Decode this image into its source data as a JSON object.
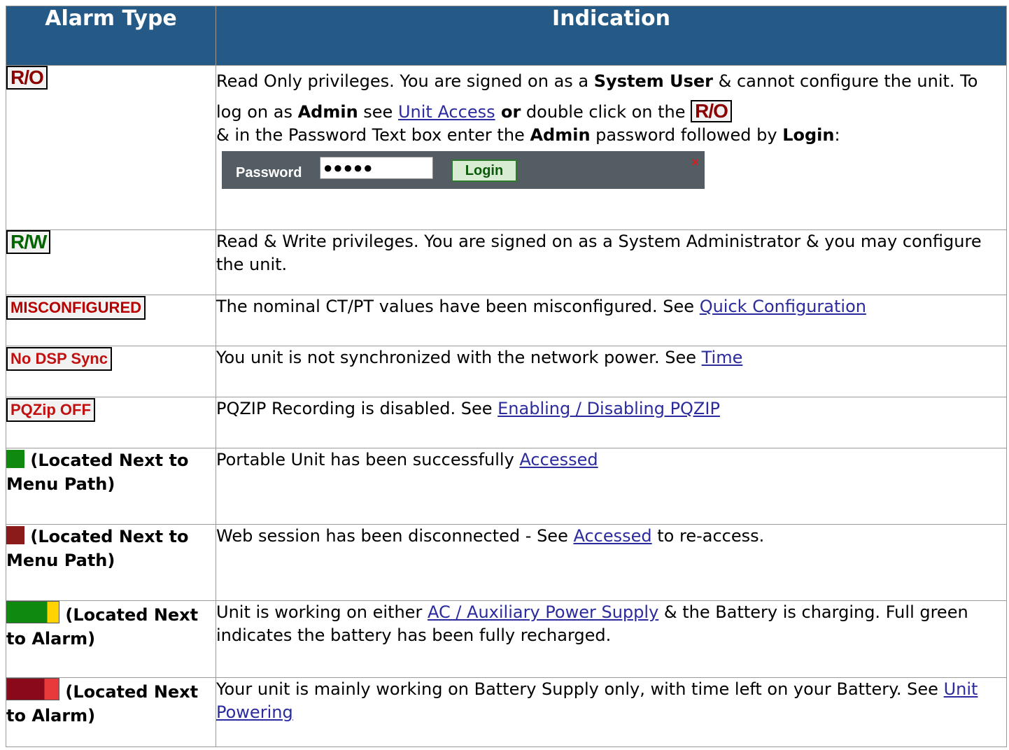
{
  "header": {
    "col1": "Alarm Type",
    "col2": "Indication"
  },
  "colors": {
    "header_bg": "#245a85",
    "green": "#0f8a0f",
    "dark_red": "#8b1a1a",
    "yellow": "#ffd400",
    "red": "#d81e1e"
  },
  "rows": [
    {
      "badge": "R/O",
      "text_a": "Read Only privileges.  You are signed on as a ",
      "bold_a": "System User",
      "text_b": " & cannot configure the unit.  To log on as ",
      "bold_b": "Admin",
      "text_c": " see ",
      "link_a": "Unit Access",
      "bold_c": " or",
      "text_d": " double click on the ",
      "badge2": "R/O",
      "text_e": " & in the Password Text box enter the ",
      "bold_d": "Admin",
      "text_f": " password followed by ",
      "bold_e": "Login",
      "text_g": ":",
      "pw_label": "Password",
      "pw_value": "●●●●●",
      "login_label": "Login",
      "close_icon": "×"
    },
    {
      "badge": "R/W",
      "text": "Read & Write privileges.  You are signed on as a System Administrator & you may configure the unit."
    },
    {
      "badge": "MISCONFIGURED",
      "text": "The nominal CT/PT values have been misconfigured.  See ",
      "link": "Quick Configuration"
    },
    {
      "badge": "No DSP Sync",
      "text": "You unit is not synchronized with the network power.  See ",
      "link": "Time"
    },
    {
      "badge": "PQZip OFF",
      "text": "PQZIP Recording is disabled.  See ",
      "link": "Enabling / Disabling PQZIP"
    },
    {
      "type_text": " (Located Next to Menu Path)",
      "text": "Portable Unit has been successfully ",
      "link": "Accessed"
    },
    {
      "type_text": " (Located Next to Menu Path)",
      "text": "Web session has been disconnected - See ",
      "link": "Accessed",
      "text2": " to re-access."
    },
    {
      "type_text": " (Located Next to Alarm)",
      "text": "Unit is working on either ",
      "link": "AC / Auxiliary Power Supply",
      "text2": " & the Battery is charging.  Full green indicates the battery has been fully recharged."
    },
    {
      "type_text": " (Located Next to Alarm)",
      "text": "Your unit is mainly working on Battery Supply only, with time left on your Battery.  See ",
      "link": "Unit Powering"
    }
  ]
}
